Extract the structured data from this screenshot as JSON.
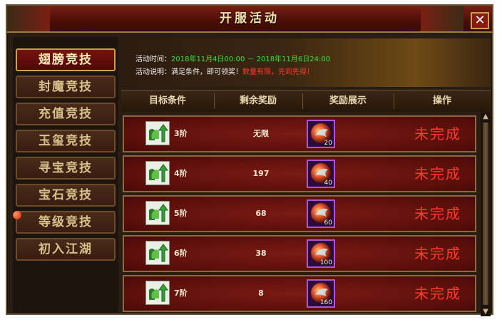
{
  "window": {
    "title": "开服活动",
    "close_label": "✕"
  },
  "nav": {
    "items": [
      {
        "label": "翅膀竞技",
        "active": true
      },
      {
        "label": "封魔竞技",
        "active": false
      },
      {
        "label": "充值竞技",
        "active": false
      },
      {
        "label": "玉玺竞技",
        "active": false
      },
      {
        "label": "寻宝竞技",
        "active": false
      },
      {
        "label": "宝石竞技",
        "active": false
      },
      {
        "label": "等级竞技",
        "active": false
      },
      {
        "label": "初入江湖",
        "active": false
      }
    ],
    "notice_item_index": 6
  },
  "banner": {
    "time_label": "活动时间：",
    "time_value": "2018年11月4日00:00 － 2018年11月6日24:00",
    "desc_label": "活动说明：满足条件，即可领奖！",
    "desc_highlight": "数量有限，先到先得！"
  },
  "table": {
    "headers": [
      "目标条件",
      "剩余奖励",
      "奖励展示",
      "操作"
    ],
    "rows": [
      {
        "icon": "wing-upgrade-icon",
        "level": "3阶",
        "remaining": "无限",
        "reward_qty": "20",
        "status": "未完成"
      },
      {
        "icon": "wing-upgrade-icon",
        "level": "4阶",
        "remaining": "197",
        "reward_qty": "40",
        "status": "未完成"
      },
      {
        "icon": "wing-upgrade-icon",
        "level": "5阶",
        "remaining": "68",
        "reward_qty": "60",
        "status": "未完成"
      },
      {
        "icon": "wing-upgrade-icon",
        "level": "6阶",
        "remaining": "38",
        "reward_qty": "100",
        "status": "未完成"
      },
      {
        "icon": "wing-upgrade-icon",
        "level": "7阶",
        "remaining": "8",
        "reward_qty": "160",
        "status": "未完成"
      }
    ]
  },
  "colors": {
    "accent_gold": "#c9a24f",
    "status_red": "#ff3b2b",
    "highlight_green": "#35e23a",
    "reward_border": "#b44fe6"
  }
}
